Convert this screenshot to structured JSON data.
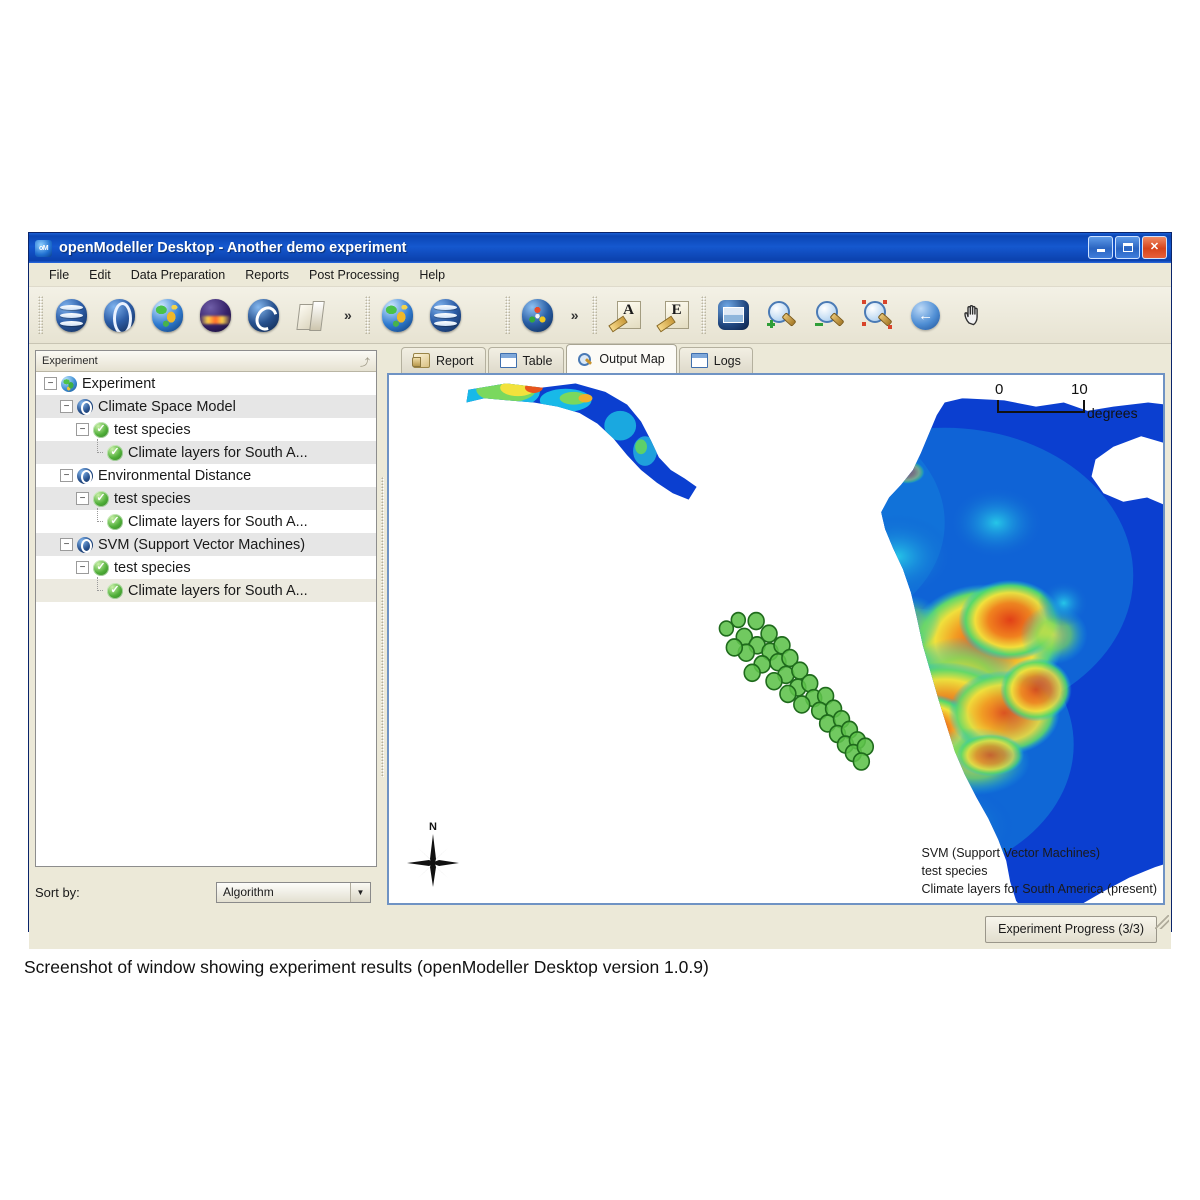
{
  "window": {
    "title": "openModeller Desktop - Another demo experiment",
    "app_icon": "om-logo-icon",
    "controls": {
      "minimize": "minimize-button",
      "maximize": "maximize-button",
      "close": "close-button"
    }
  },
  "menubar": {
    "items": [
      {
        "label": "File"
      },
      {
        "label": "Edit"
      },
      {
        "label": "Data Preparation"
      },
      {
        "label": "Reports"
      },
      {
        "label": "Post Processing"
      },
      {
        "label": "Help"
      }
    ]
  },
  "toolbar": {
    "overflow_label": "»",
    "groups": [
      {
        "buttons": [
          {
            "icon": "layers-stack-icon"
          },
          {
            "icon": "parenthesis-globe-icon"
          },
          {
            "icon": "world-map-globe-icon"
          },
          {
            "icon": "night-globe-icon"
          },
          {
            "icon": "circular-arrow-globe-icon"
          },
          {
            "icon": "folder-icon"
          }
        ]
      },
      {
        "buttons": [
          {
            "icon": "globe-map-icon"
          },
          {
            "icon": "layers-stack-blue-icon"
          }
        ]
      },
      {
        "buttons": [
          {
            "icon": "molecule-globe-icon"
          }
        ]
      },
      {
        "buttons": [
          {
            "icon": "annotate-a-icon",
            "letter": "A"
          },
          {
            "icon": "annotate-e-icon",
            "letter": "E"
          }
        ]
      },
      {
        "buttons": [
          {
            "icon": "image-export-icon"
          },
          {
            "icon": "zoom-in-icon"
          },
          {
            "icon": "zoom-out-icon"
          },
          {
            "icon": "zoom-full-extent-icon"
          },
          {
            "icon": "back-arrow-icon"
          },
          {
            "icon": "pan-hand-icon"
          }
        ]
      }
    ]
  },
  "tree": {
    "column_header": "Experiment",
    "sort_marker": "⤴",
    "nodes": [
      {
        "label": "Experiment",
        "icon": "earth-icon",
        "indent": 0,
        "toggle": "-",
        "row": "plain"
      },
      {
        "label": "Climate Space Model",
        "icon": "model-icon",
        "indent": 1,
        "toggle": "-",
        "row": "alt"
      },
      {
        "label": "test species",
        "icon": "check-icon",
        "indent": 2,
        "toggle": "-",
        "row": "plain"
      },
      {
        "label": "Climate layers for South A...",
        "icon": "check-icon",
        "indent": 3,
        "toggle": "└",
        "row": "alt"
      },
      {
        "label": "Environmental Distance",
        "icon": "model-icon",
        "indent": 1,
        "toggle": "-",
        "row": "plain"
      },
      {
        "label": "test species",
        "icon": "check-icon",
        "indent": 2,
        "toggle": "-",
        "row": "alt"
      },
      {
        "label": "Climate layers for South A...",
        "icon": "check-icon",
        "indent": 3,
        "toggle": "└",
        "row": "plain"
      },
      {
        "label": "SVM (Support Vector Machines)",
        "icon": "model-icon",
        "indent": 1,
        "toggle": "-",
        "row": "alt"
      },
      {
        "label": "test species",
        "icon": "check-icon",
        "indent": 2,
        "toggle": "-",
        "row": "plain"
      },
      {
        "label": "Climate layers for South A...",
        "icon": "check-icon",
        "indent": 3,
        "toggle": "└",
        "row": "sel"
      }
    ]
  },
  "sort": {
    "label": "Sort by:",
    "value": "Algorithm",
    "arrow": "▼"
  },
  "tabs": [
    {
      "label": "Report",
      "icon": "scroll-icon",
      "active": false
    },
    {
      "label": "Table",
      "icon": "window-icon",
      "active": false
    },
    {
      "label": "Output Map",
      "icon": "magnifier-icon",
      "active": true
    },
    {
      "label": "Logs",
      "icon": "window-icon",
      "active": false
    }
  ],
  "map": {
    "scalebar": {
      "min": "0",
      "max": "10",
      "units": "degrees"
    },
    "compass": {
      "north_label": "N"
    },
    "legend": {
      "algorithm": "SVM (Support Vector Machines)",
      "species": "test species",
      "layers": "Climate layers for South America (present)"
    },
    "colors": {
      "low": "#0b3fd0",
      "mid_low": "#18b9e8",
      "mid": "#52d96a",
      "mid_high": "#f2e23c",
      "high": "#f08a1e",
      "max": "#e03a16",
      "occurrence_point": "#5dc24a",
      "occurrence_outline": "#1f6b1c",
      "nodata": "#ffffff"
    }
  },
  "status": {
    "progress_label": "Experiment Progress (3/3)"
  },
  "caption": "Screenshot of window showing experiment results (openModeller Desktop version 1.0.9)"
}
